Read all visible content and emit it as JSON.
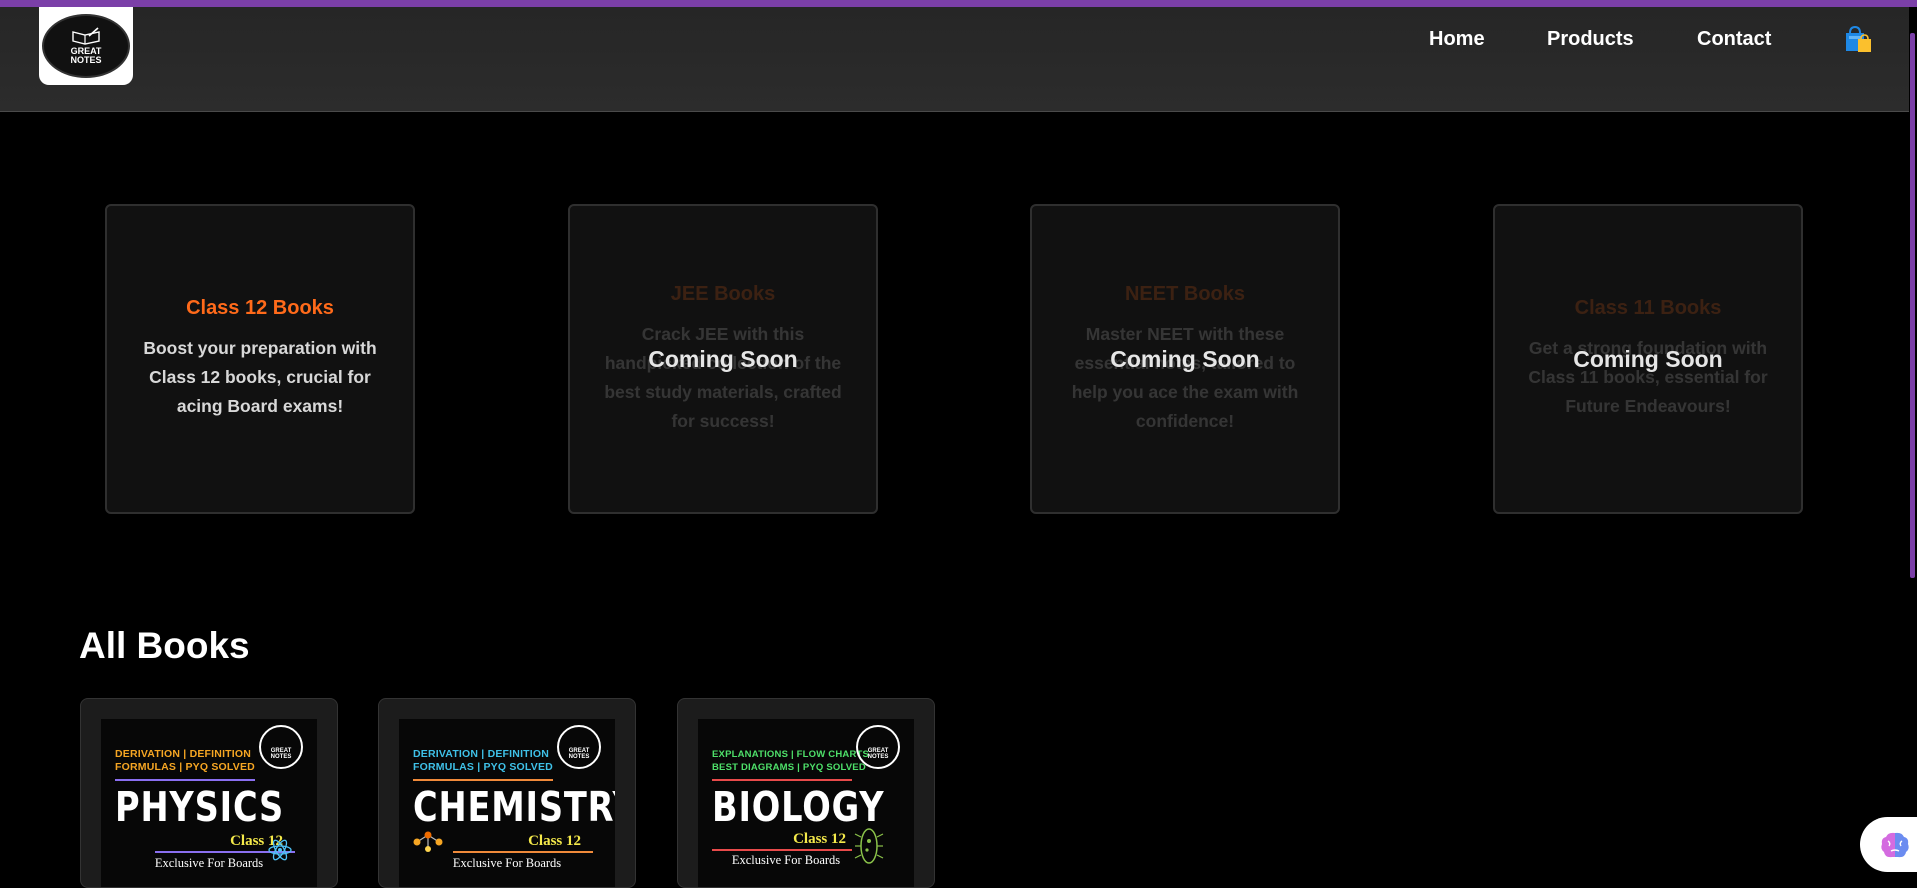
{
  "header": {
    "logo_line1": "GREAT",
    "logo_line2": "NOTES",
    "nav": [
      {
        "label": "Home"
      },
      {
        "label": "Products"
      },
      {
        "label": "Contact"
      }
    ],
    "cart_icon": "shopping-bag-icon"
  },
  "categories": [
    {
      "title": "Class 12 Books",
      "description": "Boost your preparation with Class 12 books, crucial for acing Board exams!",
      "overlay": ""
    },
    {
      "title": "JEE Books",
      "description": "Crack JEE with this handpicked collection of the best study materials, crafted for success!",
      "overlay": "Coming Soon"
    },
    {
      "title": "NEET Books",
      "description": "Master NEET with these essential notes, tailored to help you ace the exam with confidence!",
      "overlay": "Coming Soon"
    },
    {
      "title": "Class 11 Books",
      "description": "Get a strong foundation with Class 11 books, essential for Future Endeavours!",
      "overlay": "Coming Soon"
    }
  ],
  "all_books": {
    "title": "All Books",
    "books": [
      {
        "tags_line1": "DERIVATION | DEFINITION",
        "tags_line2": "FORMULAS | PYQ SOLVED",
        "subject": "PHYSICS",
        "class": "Class 12",
        "tagline": "Exclusive For Boards",
        "badge1": "GREAT",
        "badge2": "NOTES",
        "tag_color": "#f6a623",
        "rule_color": "#8a6ff0"
      },
      {
        "tags_line1": "DERIVATION | DEFINITION",
        "tags_line2": "FORMULAS | PYQ SOLVED",
        "subject": "CHEMISTRY",
        "class": "Class 12",
        "tagline": "Exclusive For Boards",
        "badge1": "GREAT",
        "badge2": "NOTES",
        "tag_color": "#3fc1e8",
        "rule_color": "#f08a3a"
      },
      {
        "tags_line1": "EXPLANATIONS | FLOW CHARTS",
        "tags_line2": "BEST DIAGRAMS | PYQ SOLVED",
        "subject": "BIOLOGY",
        "class": "Class 12",
        "tagline": "Exclusive For Boards",
        "badge1": "GREAT",
        "badge2": "NOTES",
        "tag_color": "#4ee06a",
        "rule_color": "#e84a4a"
      }
    ]
  },
  "assistant_icon": "brain-icon"
}
